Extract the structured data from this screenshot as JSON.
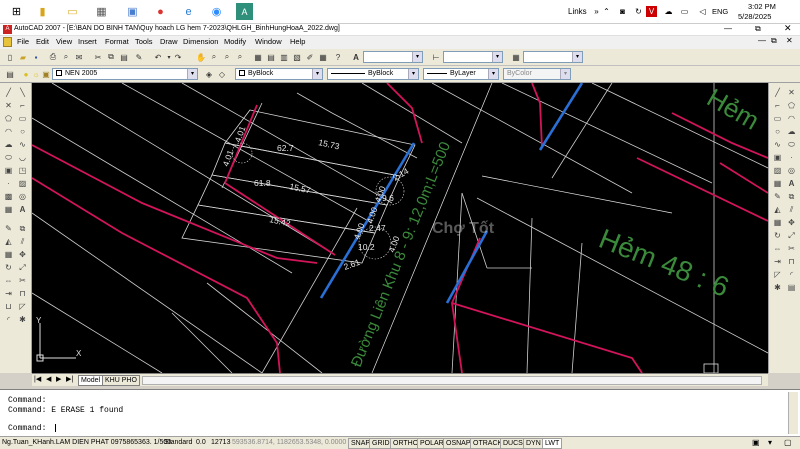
{
  "taskbar": {
    "links_label": "Links",
    "language": "ENG",
    "time": "3:02 PM",
    "date": "5/28/2025",
    "pinned_app_icons": [
      "folder-icon",
      "calculator-icon",
      "explorer-icon",
      "chrome-icon",
      "edge-icon",
      "zoom-icon",
      "autocad-icon"
    ],
    "tray_letter": "V"
  },
  "window": {
    "title": "AutoCAD 2007 - [E:\\BAN DO BINH TAN\\Quy hoach LG hem 7-2023\\QHLGH_BinhHungHoaA_2022.dwg]"
  },
  "menu": [
    "File",
    "Edit",
    "View",
    "Insert",
    "Format",
    "Tools",
    "Draw",
    "Dimension",
    "Modify",
    "Window",
    "Help"
  ],
  "properties": {
    "layer": "NEN 2005",
    "color": "ByBlock",
    "linetype": "ByBlock",
    "lineweight": "ByLayer",
    "plotstyle": "ByColor"
  },
  "drawing": {
    "street_labels": [
      "Đường Liên Khu 8 - 9: 12,0m;L=500",
      "Hẻm 48 : 6",
      "Hẻm"
    ],
    "dimensions": [
      "62.7",
      "15.73",
      "61.8",
      "15.57",
      "15.42",
      "4.01",
      "4.01",
      "4.00",
      "9.6",
      "2.14",
      "4.00",
      "2.47",
      "10.2",
      "4.00",
      "2.61",
      "4.00"
    ],
    "ucs_x": "X",
    "ucs_y": "Y",
    "watermark": "Chợ Tốt"
  },
  "layout_tabs": [
    "Model",
    "KHU PHO"
  ],
  "command": {
    "history": [
      "Command:",
      "Command: E ERASE 1 found"
    ],
    "prompt": "Command:"
  },
  "status": {
    "info_left": "Ng.Tuan_KHanh.LAM DIEN PHAT 0975865363. 1/500",
    "standard": "Standard",
    "value1": "0.0",
    "value2": "12713",
    "coordinates": "593536.8714, 1182653.5348, 0.0000",
    "toggles": [
      "SNAP",
      "GRID",
      "ORTHO",
      "POLAR",
      "OSNAP",
      "OTRACK",
      "DUCS",
      "DYN",
      "LWT"
    ]
  },
  "colors": {
    "lot_red": "#d2145a",
    "lot_white": "#c8c8c8",
    "road_blue": "#2a6fd6",
    "label_green": "#3b8a3b"
  }
}
